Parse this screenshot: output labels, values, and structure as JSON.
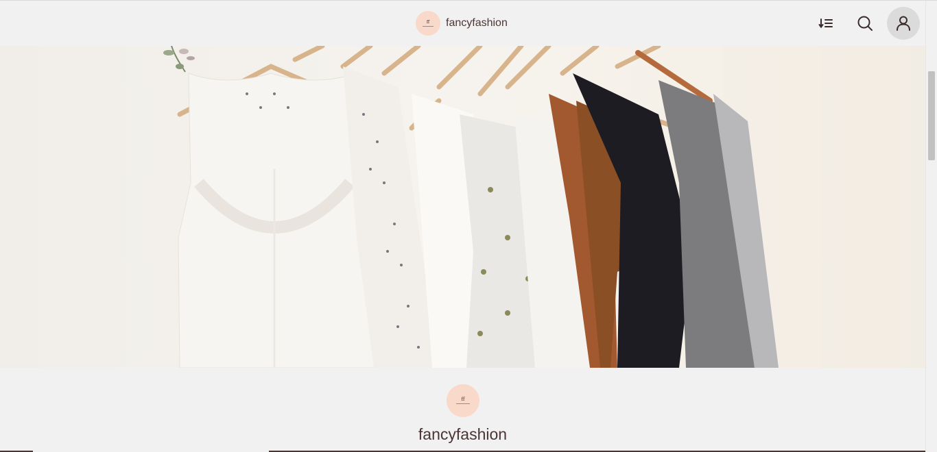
{
  "header": {
    "brand_name": "fancyfashion",
    "logo_monogram": "ff",
    "sort_icon": "sort-descending-icon",
    "search_icon": "search-icon",
    "account_icon": "user-icon"
  },
  "hero": {
    "image": "clothing-rack-photo"
  },
  "profile": {
    "logo_monogram": "ff",
    "name": "fancyfashion"
  },
  "colors": {
    "background": "#f2f1f1",
    "logo_bg": "#f9d9c9",
    "text": "#4a3535",
    "account_bg": "#dcdbdb"
  }
}
